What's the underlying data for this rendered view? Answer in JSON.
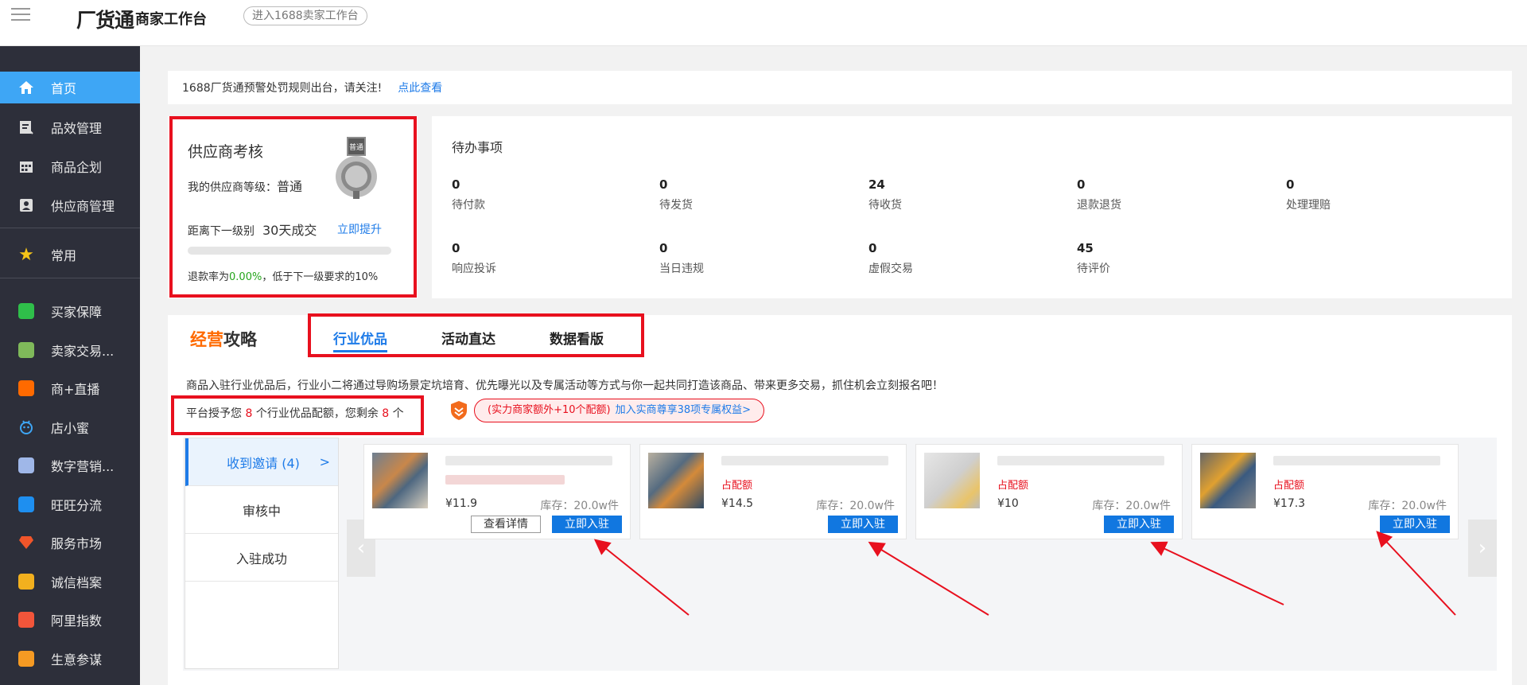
{
  "header": {
    "logo": "厂货通",
    "subtitle": "商家工作台",
    "enter_button": "进入1688卖家工作台"
  },
  "sidebar": {
    "items": [
      {
        "label": "首页",
        "icon": "home-icon"
      },
      {
        "label": "品效管理",
        "icon": "chart-icon"
      },
      {
        "label": "商品企划",
        "icon": "calendar-icon"
      },
      {
        "label": "供应商管理",
        "icon": "id-card-icon"
      },
      {
        "label": "常用",
        "icon": "star-icon"
      },
      {
        "label": "买家保障",
        "icon": "shield-icon"
      },
      {
        "label": "卖家交易...",
        "icon": "user-icon"
      },
      {
        "label": "商+直播",
        "icon": "live-icon"
      },
      {
        "label": "店小蜜",
        "icon": "robot-icon"
      },
      {
        "label": "数字营销...",
        "icon": "marketing-icon"
      },
      {
        "label": "旺旺分流",
        "icon": "wangwang-icon"
      },
      {
        "label": "服务市场",
        "icon": "diamond-icon"
      },
      {
        "label": "诚信档案",
        "icon": "badge-icon"
      },
      {
        "label": "阿里指数",
        "icon": "trend-icon"
      },
      {
        "label": "生意参谋",
        "icon": "compass-icon"
      }
    ]
  },
  "notice": {
    "text": "1688厂货通预警处罚规则出台，请关注!",
    "link": "点此查看"
  },
  "supplier": {
    "title": "供应商考核",
    "level_label": "我的供应商等级：",
    "level_value": "普通",
    "medal_label": "普通",
    "next_label": "距离下一级别",
    "next_value": "30天成交",
    "upgrade_link": "立即提升",
    "progress": 0,
    "rate_prefix": "退款率为",
    "rate_value": "0.00%",
    "rate_suffix": "，低于下一级要求的10%"
  },
  "todo": {
    "title": "待办事项",
    "items": [
      {
        "value": "0",
        "label": "待付款"
      },
      {
        "value": "0",
        "label": "待发货"
      },
      {
        "value": "24",
        "label": "待收货"
      },
      {
        "value": "0",
        "label": "退款退货"
      },
      {
        "value": "0",
        "label": "处理理赔"
      },
      {
        "value": "0",
        "label": "响应投诉"
      },
      {
        "value": "0",
        "label": "当日违规"
      },
      {
        "value": "0",
        "label": "虚假交易"
      },
      {
        "value": "45",
        "label": "待评价"
      }
    ]
  },
  "strategy": {
    "logo_part1": "经营",
    "logo_part2": "攻略",
    "tabs": [
      "行业优品",
      "活动直达",
      "数据看版"
    ],
    "description": "商品入驻行业优品后，行业小二将通过导购场景定坑培育、优先曝光以及专属活动等方式与你一起共同打造该商品、带来更多交易，抓住机会立刻报名吧！",
    "quota_prefix": "平台授予您",
    "quota_total": "8",
    "quota_middle": "个行业优品配额，您剩余",
    "quota_left": "8",
    "quota_suffix": "个",
    "promo_text": "(实力商家额外+10个配额)",
    "promo_link": "加入实商尊享38项专属权益>"
  },
  "invites": {
    "side": [
      {
        "label": "收到邀请 (4)",
        "arrow": ">"
      },
      {
        "label": "审核中"
      },
      {
        "label": "入驻成功"
      }
    ],
    "cards": [
      {
        "price": "¥11.9",
        "stock": "库存：20.0w件",
        "tag": "",
        "detail": "查看详情",
        "join": "立即入驻"
      },
      {
        "price": "¥14.5",
        "stock": "库存：20.0w件",
        "tag": "占配额",
        "join": "立即入驻"
      },
      {
        "price": "¥10",
        "stock": "库存：20.0w件",
        "tag": "占配额",
        "join": "立即入驻"
      },
      {
        "price": "¥17.3",
        "stock": "库存：20.0w件",
        "tag": "占配额",
        "join": "立即入驻"
      }
    ],
    "prev": "‹",
    "next": "›"
  },
  "colors": {
    "accent": "#1e7be8",
    "sidebar_bg": "#2d2f3a",
    "active_item": "#3ea6f5",
    "annotation_red": "#e8101e",
    "brand_orange": "#ff6a00"
  }
}
